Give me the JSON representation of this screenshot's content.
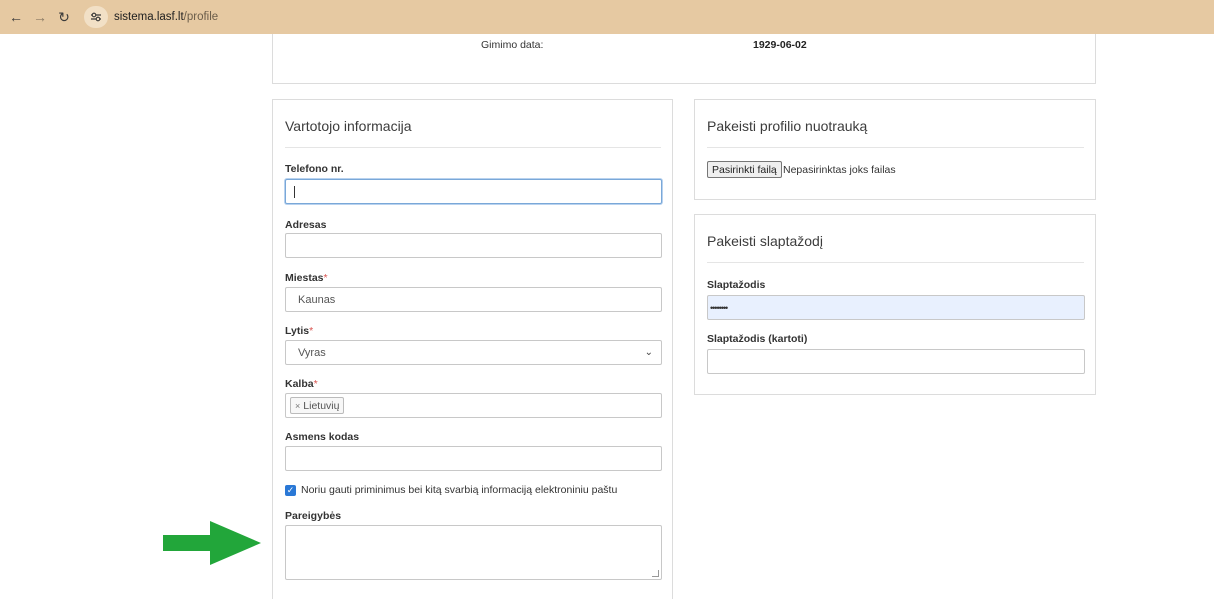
{
  "browser": {
    "url_host": "sistema.lasf.lt",
    "url_path": "/profile",
    "icons": [
      "back-icon",
      "forward-icon",
      "reload-icon",
      "site-settings-icon"
    ]
  },
  "top_card": {
    "birth_label": "Gimimo data:",
    "birth_value": "1929-06-02"
  },
  "user_info": {
    "title": "Vartotojo informacija",
    "phone_label": "Telefono nr.",
    "phone_value": "",
    "address_label": "Adresas",
    "address_value": "",
    "city_label": "Miestas",
    "city_value": "Kaunas",
    "gender_label": "Lytis",
    "gender_value": "Vyras",
    "language_label": "Kalba",
    "language_tag": "Lietuvių",
    "personal_code_label": "Asmens kodas",
    "personal_code_value": "",
    "email_reminders_label": "Noriu gauti priminimus bei kitą svarbią informaciją elektroniniu paštu",
    "email_reminders_checked": true,
    "duties_label": "Pareigybės",
    "required_mark": "*"
  },
  "photo_card": {
    "title": "Pakeisti profilio nuotrauką",
    "choose_file_label": "Pasirinkti failą",
    "no_file_text": "Nepasirinktas joks failas"
  },
  "password_card": {
    "title": "Pakeisti slaptažodį",
    "password_label": "Slaptažodis",
    "password_value": "••••••••",
    "password_repeat_label": "Slaptažodis (kartoti)",
    "password_repeat_value": ""
  },
  "colors": {
    "chrome_bg": "#e6c9a2",
    "checkbox_blue": "#2a78d6",
    "required_red": "#d9534f",
    "arrow_green": "#22a63a",
    "autofill_bg": "#e8f0fe"
  }
}
